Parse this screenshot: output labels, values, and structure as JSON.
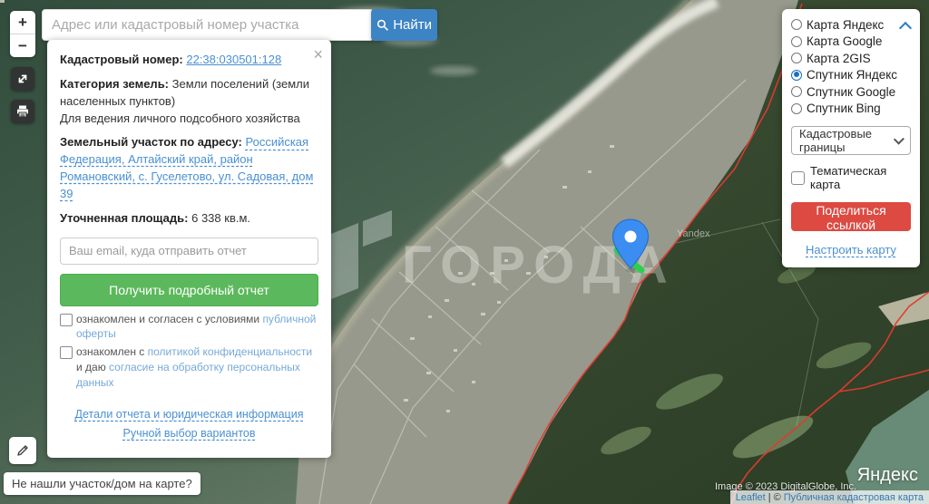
{
  "search": {
    "placeholder": "Адрес или кадастровый номер участка",
    "button_label": "Найти"
  },
  "map_controls": {
    "zoom_in": "+",
    "zoom_out": "−",
    "not_found_button": "Не нашли участок/дом на карте?"
  },
  "info_panel": {
    "cadastral_label": "Кадастровый номер:",
    "cadastral_number": "22:38:030501:128",
    "close": "×",
    "category_label": "Категория земель:",
    "category_value": "Земли поселений (земли населенных пунктов)",
    "usage_value": "Для ведения личного подсобного хозяйства",
    "address_label": "Земельный участок по адресу:",
    "address_link": "Российская Федерация, Алтайский край, район Романовский, с. Гуселетово, ул. Садовая, дом 39",
    "area_label": "Уточненная площадь:",
    "area_value": "6 338 кв.м.",
    "email_placeholder": "Ваш email, куда отправить отчет",
    "report_button": "Получить подробный отчет",
    "agree1_text": "ознакомлен и согласен с условиями ",
    "agree1_link": "публичной оферты",
    "agree2_text1": "ознакомлен с ",
    "agree2_link1": "политикой конфиденциальности",
    "agree2_text2": " и даю ",
    "agree2_link2": "согласие на обработку персональных данных",
    "details_link": "Детали отчета и юридическая информация",
    "manual_link": "Ручной выбор вариантов"
  },
  "layers_panel": {
    "options": [
      {
        "label": "Карта Яндекс",
        "selected": false
      },
      {
        "label": "Карта Google",
        "selected": false
      },
      {
        "label": "Карта 2GIS",
        "selected": false
      },
      {
        "label": "Спутник Яндекс",
        "selected": true
      },
      {
        "label": "Спутник Google",
        "selected": false
      },
      {
        "label": "Спутник Bing",
        "selected": false
      }
    ],
    "overlay_select_value": "Кадастровые границы",
    "thematic_checkbox_label": "Тематическая карта",
    "share_button": "Поделиться ссылкой",
    "configure_link": "Настроить карту"
  },
  "attribution": {
    "image_credit": "Image © 2023 DigitalGlobe, Inc.",
    "leaflet_link": "Leaflet",
    "separator": "| ©",
    "pkk_link": "Публичная кадастровая карта",
    "yandex_logo": "Яндекс",
    "yandex_small": "Yandex"
  },
  "watermark": {
    "text": "ГОРОДА"
  },
  "colors": {
    "search_blue": "#3d84c4",
    "report_green": "#5cb85c",
    "share_red": "#dc4a42",
    "link_blue": "#4a90d2",
    "boundary_red": "#e23b30",
    "pin_blue": "#3b8df2",
    "measure_green": "#2ece4d"
  }
}
